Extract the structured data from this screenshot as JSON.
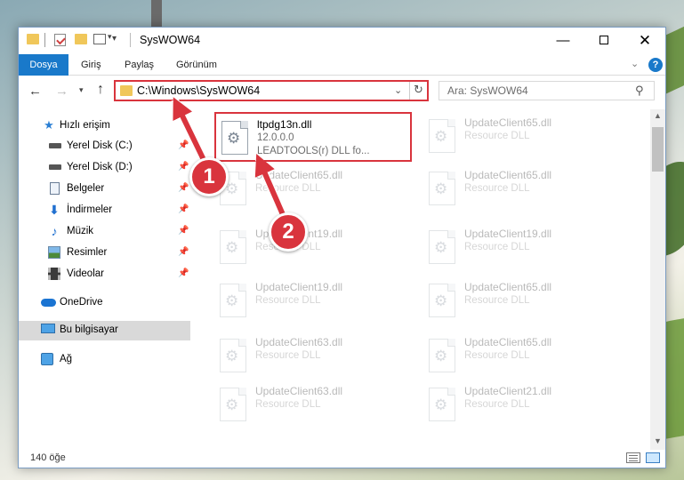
{
  "window": {
    "title": "SysWOW64"
  },
  "ribbon": {
    "tabs": [
      "Dosya",
      "Giriş",
      "Paylaş",
      "Görünüm"
    ],
    "help": "?"
  },
  "address": {
    "path": "C:\\Windows\\SysWOW64",
    "search_placeholder": "Ara: SysWOW64"
  },
  "sidebar": {
    "items": [
      {
        "label": "Hızlı erişim",
        "icon": "star-icon"
      },
      {
        "label": "Yerel Disk (C:)",
        "icon": "drive-icon"
      },
      {
        "label": "Yerel Disk (D:)",
        "icon": "drive-icon"
      },
      {
        "label": "Belgeler",
        "icon": "documents-icon"
      },
      {
        "label": "İndirmeler",
        "icon": "download-icon"
      },
      {
        "label": "Müzik",
        "icon": "music-icon"
      },
      {
        "label": "Resimler",
        "icon": "pictures-icon"
      },
      {
        "label": "Videolar",
        "icon": "videos-icon"
      },
      {
        "label": "OneDrive",
        "icon": "cloud-icon"
      },
      {
        "label": "Bu bilgisayar",
        "icon": "computer-icon"
      },
      {
        "label": "Ağ",
        "icon": "network-icon"
      }
    ]
  },
  "files": {
    "highlighted": {
      "name": "ltpdg13n.dll",
      "version": "12.0.0.0",
      "desc": "LEADTOOLS(r) DLL fo..."
    },
    "left": [
      {
        "name": "UpdateClient65.dll",
        "desc": "Resource DLL"
      },
      {
        "name": "UpdateClient19.dll",
        "desc": "Resource DLL"
      },
      {
        "name": "UpdateClient19.dll",
        "desc": "Resource DLL"
      },
      {
        "name": "UpdateClient63.dll",
        "desc": "Resource DLL"
      },
      {
        "name": "UpdateClient63.dll",
        "desc": "Resource DLL"
      }
    ],
    "right": [
      {
        "name": "UpdateClient65.dll",
        "desc": "Resource DLL"
      },
      {
        "name": "UpdateClient65.dll",
        "desc": "Resource DLL"
      },
      {
        "name": "UpdateClient19.dll",
        "desc": "Resource DLL"
      },
      {
        "name": "UpdateClient65.dll",
        "desc": "Resource DLL"
      },
      {
        "name": "UpdateClient65.dll",
        "desc": "Resource DLL"
      },
      {
        "name": "UpdateClient21.dll",
        "desc": "Resource DLL"
      }
    ]
  },
  "status": {
    "count": "140 öğe"
  },
  "annotations": {
    "badge1": "1",
    "badge2": "2",
    "color": "#d9343d"
  }
}
